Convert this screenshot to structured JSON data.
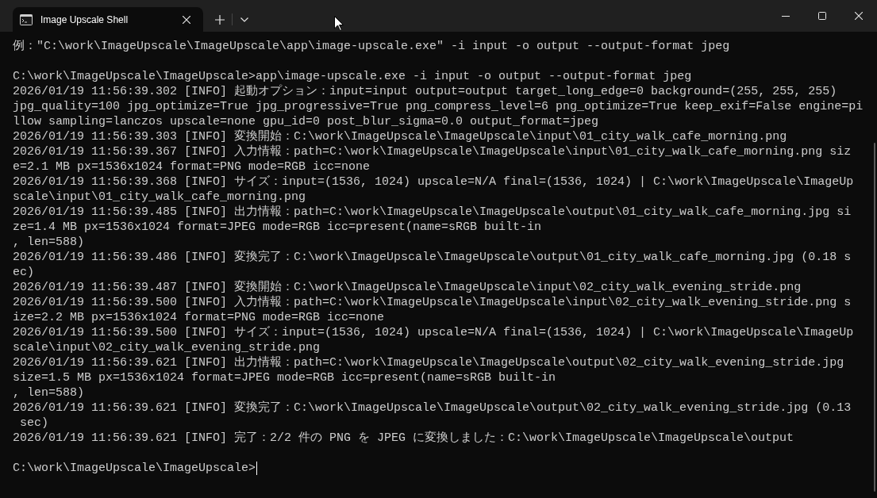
{
  "tabs": [
    {
      "title": "Image Upscale Shell",
      "selected": true
    }
  ],
  "terminal": {
    "lines": [
      {
        "kind": "text",
        "text": "例：\"C:\\work\\ImageUpscale\\ImageUpscale\\app\\image-upscale.exe\" -i input -o output --output-format jpeg"
      },
      {
        "kind": "blank"
      },
      {
        "kind": "text",
        "text": "C:\\work\\ImageUpscale\\ImageUpscale>app\\image-upscale.exe -i input -o output --output-format jpeg"
      },
      {
        "kind": "text",
        "text": "2026/01/19 11:56:39.302 [INFO] 起動オプション：input=input output=output target_long_edge=0 background=(255, 255, 255)"
      },
      {
        "kind": "text",
        "text": "jpg_quality=100 jpg_optimize=True jpg_progressive=True png_compress_level=6 png_optimize=True keep_exif=False engine=pi"
      },
      {
        "kind": "text",
        "text": "llow sampling=lanczos upscale=none gpu_id=0 post_blur_sigma=0.0 output_format=jpeg"
      },
      {
        "kind": "text",
        "text": "2026/01/19 11:56:39.303 [INFO] 変換開始：C:\\work\\ImageUpscale\\ImageUpscale\\input\\01_city_walk_cafe_morning.png"
      },
      {
        "kind": "text",
        "text": "2026/01/19 11:56:39.367 [INFO] 入力情報：path=C:\\work\\ImageUpscale\\ImageUpscale\\input\\01_city_walk_cafe_morning.png siz"
      },
      {
        "kind": "text",
        "text": "e=2.1 MB px=1536x1024 format=PNG mode=RGB icc=none"
      },
      {
        "kind": "text",
        "text": "2026/01/19 11:56:39.368 [INFO] サイズ：input=(1536, 1024) upscale=N/A final=(1536, 1024) | C:\\work\\ImageUpscale\\ImageUp"
      },
      {
        "kind": "text",
        "text": "scale\\input\\01_city_walk_cafe_morning.png"
      },
      {
        "kind": "text",
        "text": "2026/01/19 11:56:39.485 [INFO] 出力情報：path=C:\\work\\ImageUpscale\\ImageUpscale\\output\\01_city_walk_cafe_morning.jpg si"
      },
      {
        "kind": "text",
        "text": "ze=1.4 MB px=1536x1024 format=JPEG mode=RGB icc=present(name=sRGB built-in"
      },
      {
        "kind": "text",
        "text": ", len=588)"
      },
      {
        "kind": "text",
        "text": "2026/01/19 11:56:39.486 [INFO] 変換完了：C:\\work\\ImageUpscale\\ImageUpscale\\output\\01_city_walk_cafe_morning.jpg (0.18 s"
      },
      {
        "kind": "text",
        "text": "ec)"
      },
      {
        "kind": "text",
        "text": "2026/01/19 11:56:39.487 [INFO] 変換開始：C:\\work\\ImageUpscale\\ImageUpscale\\input\\02_city_walk_evening_stride.png"
      },
      {
        "kind": "text",
        "text": "2026/01/19 11:56:39.500 [INFO] 入力情報：path=C:\\work\\ImageUpscale\\ImageUpscale\\input\\02_city_walk_evening_stride.png s"
      },
      {
        "kind": "text",
        "text": "ize=2.2 MB px=1536x1024 format=PNG mode=RGB icc=none"
      },
      {
        "kind": "text",
        "text": "2026/01/19 11:56:39.500 [INFO] サイズ：input=(1536, 1024) upscale=N/A final=(1536, 1024) | C:\\work\\ImageUpscale\\ImageUp"
      },
      {
        "kind": "text",
        "text": "scale\\input\\02_city_walk_evening_stride.png"
      },
      {
        "kind": "text",
        "text": "2026/01/19 11:56:39.621 [INFO] 出力情報：path=C:\\work\\ImageUpscale\\ImageUpscale\\output\\02_city_walk_evening_stride.jpg"
      },
      {
        "kind": "text",
        "text": "size=1.5 MB px=1536x1024 format=JPEG mode=RGB icc=present(name=sRGB built-in"
      },
      {
        "kind": "text",
        "text": ", len=588)"
      },
      {
        "kind": "text",
        "text": "2026/01/19 11:56:39.621 [INFO] 変換完了：C:\\work\\ImageUpscale\\ImageUpscale\\output\\02_city_walk_evening_stride.jpg (0.13"
      },
      {
        "kind": "text",
        "text": " sec)"
      },
      {
        "kind": "text",
        "text": "2026/01/19 11:56:39.621 [INFO] 完了：2/2 件の PNG を JPEG に変換しました：C:\\work\\ImageUpscale\\ImageUpscale\\output"
      },
      {
        "kind": "blank"
      },
      {
        "kind": "prompt",
        "text": "C:\\work\\ImageUpscale\\ImageUpscale>",
        "cursor": true
      }
    ]
  }
}
